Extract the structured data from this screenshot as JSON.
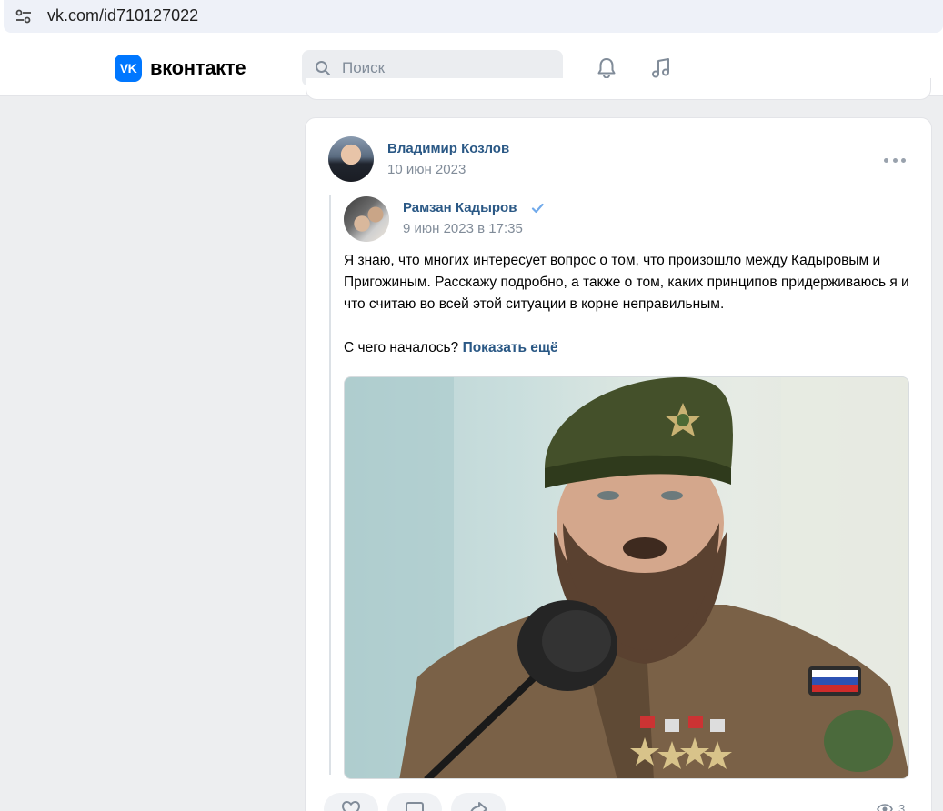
{
  "browser": {
    "url": "vk.com/id710127022"
  },
  "header": {
    "logo_text": "VK",
    "brand": "вконтакте",
    "search_placeholder": "Поиск"
  },
  "post": {
    "author": "Владимир Козлов",
    "date": "10 июн 2023",
    "repost": {
      "author": "Рамзан Кадыров",
      "verified": true,
      "date": "9 июн 2023 в 17:35",
      "text_p1": "Я знаю, что многих интересует вопрос о том, что произошло между Кадыровым и Пригожиным. Расскажу подробно, а также о том, каких принципов придерживаюсь я и что считаю во всей этой ситуации в корне неправильным.",
      "text_p2": "С чего началось?",
      "show_more": "Показать ещё"
    },
    "views": "3"
  },
  "colors": {
    "accent": "#0077ff",
    "link": "#2a5885",
    "meta": "#818c99",
    "page_bg": "#edeef0"
  },
  "icons": {
    "site_settings": "tune-icon",
    "search": "search-icon",
    "notifications": "bell-icon",
    "music": "music-note-icon",
    "more": "more-horizontal-icon",
    "verified": "checkmark-icon",
    "like": "heart-icon",
    "comment": "comment-icon",
    "share": "share-icon",
    "views": "eye-icon"
  }
}
